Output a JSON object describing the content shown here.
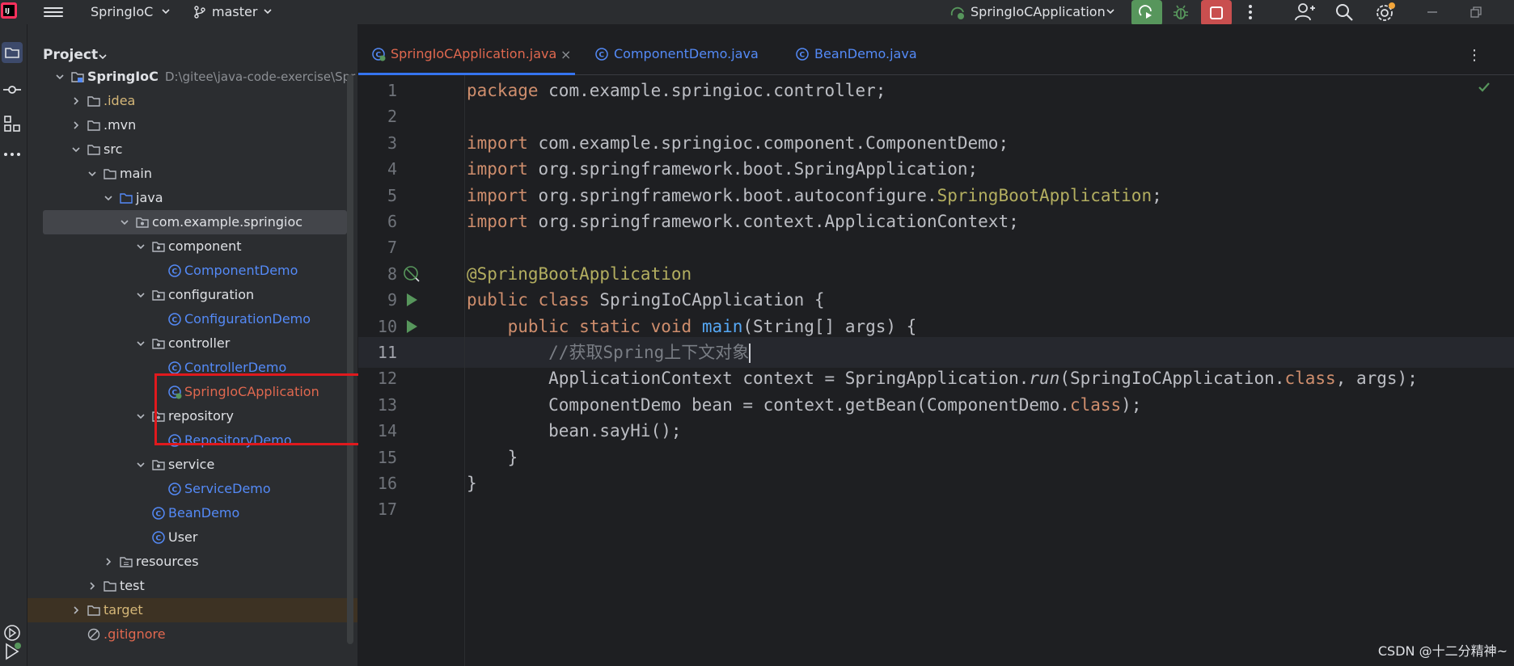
{
  "titlebar": {
    "project_name": "SpringIoC",
    "branch": "master",
    "run_config": "SpringIoCApplication"
  },
  "project_panel": {
    "title": "Project",
    "tree": [
      {
        "label": "SpringIoC",
        "path": "D:\\gitee\\java-code-exercise\\Spr",
        "type": "module",
        "depth": 0,
        "expanded": true
      },
      {
        "label": ".idea",
        "type": "folder",
        "depth": 1,
        "expanded": false,
        "color": "#d5b778"
      },
      {
        "label": ".mvn",
        "type": "folder",
        "depth": 1,
        "expanded": false
      },
      {
        "label": "src",
        "type": "folder",
        "depth": 1,
        "expanded": true
      },
      {
        "label": "main",
        "type": "folder",
        "depth": 2,
        "expanded": true
      },
      {
        "label": "java",
        "type": "source-folder",
        "depth": 3,
        "expanded": true
      },
      {
        "label": "com.example.springioc",
        "type": "package",
        "depth": 4,
        "expanded": true,
        "selected": true
      },
      {
        "label": "component",
        "type": "package",
        "depth": 5,
        "expanded": true
      },
      {
        "label": "ComponentDemo",
        "type": "class",
        "depth": 6,
        "color": "#548af7"
      },
      {
        "label": "configuration",
        "type": "package",
        "depth": 5,
        "expanded": true
      },
      {
        "label": "ConfigurationDemo",
        "type": "class",
        "depth": 6,
        "color": "#548af7"
      },
      {
        "label": "controller",
        "type": "package",
        "depth": 5,
        "expanded": true
      },
      {
        "label": "ControllerDemo",
        "type": "class",
        "depth": 6,
        "color": "#548af7"
      },
      {
        "label": "SpringIoCApplication",
        "type": "spring-class",
        "depth": 6,
        "color": "#e0684f"
      },
      {
        "label": "repository",
        "type": "package",
        "depth": 5,
        "expanded": true
      },
      {
        "label": "RepositoryDemo",
        "type": "class",
        "depth": 6,
        "color": "#548af7"
      },
      {
        "label": "service",
        "type": "package",
        "depth": 5,
        "expanded": true
      },
      {
        "label": "ServiceDemo",
        "type": "class",
        "depth": 6,
        "color": "#548af7"
      },
      {
        "label": "BeanDemo",
        "type": "class",
        "depth": 5,
        "color": "#548af7"
      },
      {
        "label": "User",
        "type": "class",
        "depth": 5
      },
      {
        "label": "resources",
        "type": "resources-folder",
        "depth": 3,
        "expanded": false
      },
      {
        "label": "test",
        "type": "folder",
        "depth": 2,
        "expanded": false
      },
      {
        "label": "target",
        "type": "folder",
        "depth": 1,
        "expanded": false,
        "color": "#d5b778",
        "excluded": true
      },
      {
        "label": ".gitignore",
        "type": "ignore-file",
        "depth": 1,
        "color": "#e0684f"
      }
    ]
  },
  "tabs": [
    {
      "label": "SpringIoCApplication.java",
      "active": true,
      "color": "#e0684f",
      "close": "×"
    },
    {
      "label": "ComponentDemo.java",
      "active": false,
      "color": "#548af7"
    },
    {
      "label": "BeanDemo.java",
      "active": false,
      "color": "#548af7"
    }
  ],
  "editor": {
    "current_line": 11,
    "lines": [
      {
        "n": "1",
        "tokens": [
          [
            "kw",
            "package"
          ],
          [
            "txt",
            " com.example.springioc.controller;"
          ]
        ]
      },
      {
        "n": "2",
        "tokens": []
      },
      {
        "n": "3",
        "tokens": [
          [
            "kw",
            "import"
          ],
          [
            "txt",
            " com.example.springioc.component.ComponentDemo;"
          ]
        ]
      },
      {
        "n": "4",
        "tokens": [
          [
            "kw",
            "import"
          ],
          [
            "txt",
            " org.springframework.boot.SpringApplication;"
          ]
        ]
      },
      {
        "n": "5",
        "tokens": [
          [
            "kw",
            "import"
          ],
          [
            "txt",
            " org.springframework.boot.autoconfigure."
          ],
          [
            "ann",
            "SpringBootApplication"
          ],
          [
            "txt",
            ";"
          ]
        ]
      },
      {
        "n": "6",
        "tokens": [
          [
            "kw",
            "import"
          ],
          [
            "txt",
            " org.springframework.context.ApplicationContext;"
          ]
        ]
      },
      {
        "n": "7",
        "tokens": []
      },
      {
        "n": "8",
        "tokens": [
          [
            "ann",
            "@SpringBootApplication"
          ]
        ],
        "gutter": "spring-bean-icon"
      },
      {
        "n": "9",
        "tokens": [
          [
            "kw",
            "public class"
          ],
          [
            "txt",
            " SpringIoCApplication {"
          ]
        ],
        "gutter": "run-gutter-icon"
      },
      {
        "n": "10",
        "tokens": [
          [
            "txt",
            "    "
          ],
          [
            "kw",
            "public static void"
          ],
          [
            "txt",
            " "
          ],
          [
            "fn",
            "main"
          ],
          [
            "txt",
            "(String[] args) {"
          ]
        ],
        "gutter": "run-gutter-icon"
      },
      {
        "n": "11",
        "tokens": [
          [
            "txt",
            "        "
          ],
          [
            "cmt",
            "//获取Spring上下文对象"
          ]
        ],
        "caret": true
      },
      {
        "n": "12",
        "tokens": [
          [
            "txt",
            "        ApplicationContext context = SpringApplication."
          ],
          [
            "it",
            "run"
          ],
          [
            "txt",
            "(SpringIoCApplication."
          ],
          [
            "kw",
            "class"
          ],
          [
            "txt",
            ", args);"
          ]
        ]
      },
      {
        "n": "13",
        "tokens": [
          [
            "txt",
            "        ComponentDemo bean = context.getBean(ComponentDemo."
          ],
          [
            "kw",
            "class"
          ],
          [
            "txt",
            ");"
          ]
        ]
      },
      {
        "n": "14",
        "tokens": [
          [
            "txt",
            "        bean.sayHi();"
          ]
        ]
      },
      {
        "n": "15",
        "tokens": [
          [
            "txt",
            "    }"
          ]
        ]
      },
      {
        "n": "16",
        "tokens": [
          [
            "txt",
            "}"
          ]
        ]
      },
      {
        "n": "17",
        "tokens": []
      }
    ]
  },
  "watermark": "CSDN @十二分精神~",
  "colors": {
    "accent": "#3574f0",
    "run": "#57965c",
    "stop": "#c94f4f",
    "highlight_box": "#e0191d"
  }
}
